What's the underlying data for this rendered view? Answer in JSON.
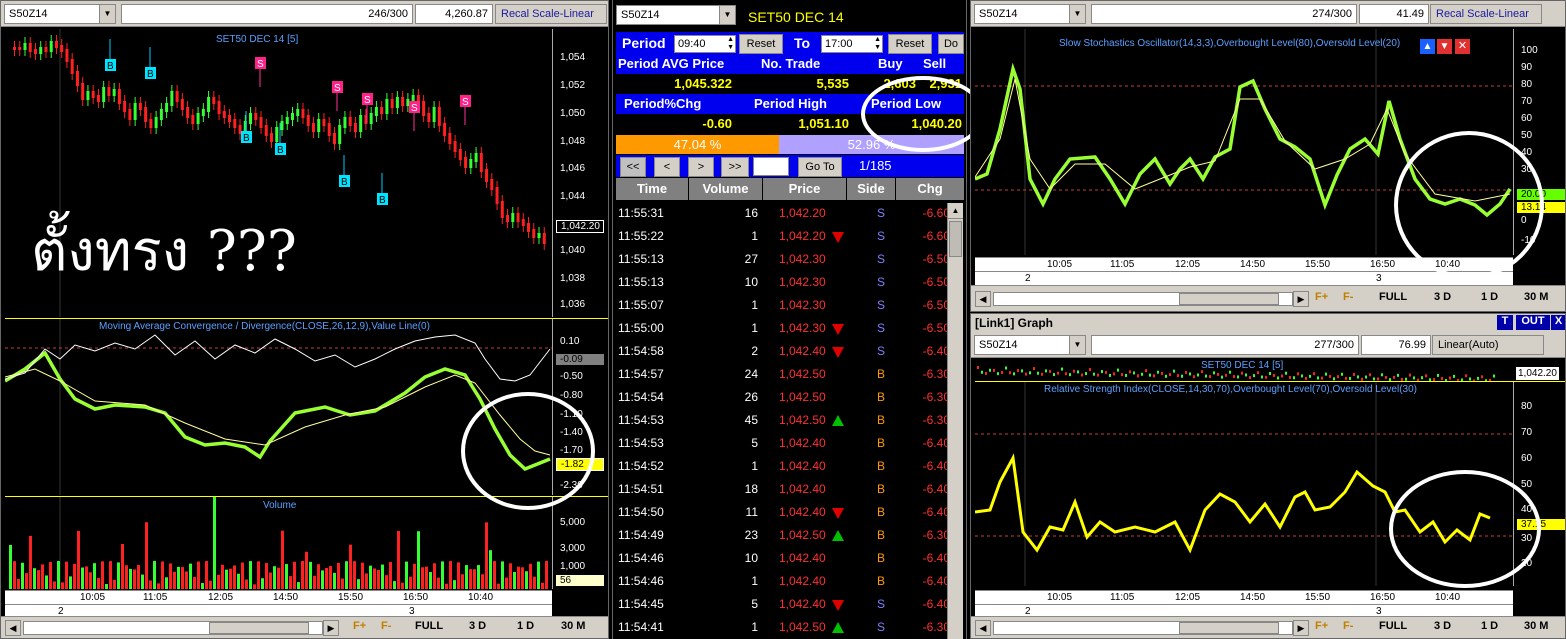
{
  "left_pane": {
    "symbol": "S50Z14",
    "counter": "246/300",
    "value": "4,260.87",
    "scale_button": "Recal Scale-Linear",
    "price_chart_label": "SET50 DEC 14   [5]",
    "price_ticks": [
      "1,054",
      "1,052",
      "1,050",
      "1,048",
      "1,046",
      "1,044",
      "1,042.20",
      "1,040",
      "1,038",
      "1,036"
    ],
    "macd_label": "Moving Average Convergence / Divergence(CLOSE,26,12,9),Value Line(0)",
    "macd_ticks": [
      "0.10",
      "-0.09",
      "-0.50",
      "-0.80",
      "-1.10",
      "-1.40",
      "-1.70",
      "-1.82",
      "-2.30"
    ],
    "volume_label": "Volume",
    "volume_ticks": [
      "5,000",
      "3,000",
      "1,000",
      "56"
    ],
    "x_ticks": [
      "10:05",
      "11:05",
      "12:05",
      "14:50",
      "15:50",
      "16:50",
      "10:40"
    ],
    "day_markers": [
      "2",
      "3"
    ],
    "bottom_buttons": [
      "F+",
      "F-",
      "FULL",
      "3 D",
      "1 D",
      "30 M"
    ],
    "thai_annotation": "ตั้งทรง ???",
    "signals_b": [
      "B",
      "B",
      "B",
      "B",
      "B",
      "B"
    ],
    "signals_s": [
      "S",
      "S",
      "S",
      "S",
      "S"
    ]
  },
  "middle_pane": {
    "symbol": "S50Z14",
    "title": "SET50 DEC 14",
    "period_label": "Period",
    "period_from": "09:40",
    "to_label": "To",
    "period_to": "17:00",
    "reset_label": "Reset",
    "do_label": "Do",
    "headers1": [
      "Period AVG Price",
      "No. Trade",
      "Buy",
      "Sell"
    ],
    "values1": [
      "1,045.322",
      "5,535",
      "2,603",
      "2,931"
    ],
    "headers2": [
      "Period%Chg",
      "Period High",
      "Period Low"
    ],
    "values2": [
      "-0.60",
      "1,051.10",
      "1,040.20"
    ],
    "buy_pct": "47.04 %",
    "sell_pct": "52.96 %",
    "nav_buttons": [
      "<<",
      "<",
      ">",
      ">>"
    ],
    "goto_label": "Go To",
    "page_info": "1/185",
    "table_headers": [
      "Time",
      "Volume",
      "Price",
      "Side",
      "Chg"
    ],
    "rows": [
      {
        "time": "11:55:31",
        "vol": "16",
        "price": "1,042.20",
        "arrow": "",
        "side": "S",
        "chg": "-6.60"
      },
      {
        "time": "11:55:22",
        "vol": "1",
        "price": "1,042.20",
        "arrow": "down",
        "side": "S",
        "chg": "-6.60"
      },
      {
        "time": "11:55:13",
        "vol": "27",
        "price": "1,042.30",
        "arrow": "",
        "side": "S",
        "chg": "-6.50"
      },
      {
        "time": "11:55:13",
        "vol": "10",
        "price": "1,042.30",
        "arrow": "",
        "side": "S",
        "chg": "-6.50"
      },
      {
        "time": "11:55:07",
        "vol": "1",
        "price": "1,042.30",
        "arrow": "",
        "side": "S",
        "chg": "-6.50"
      },
      {
        "time": "11:55:00",
        "vol": "1",
        "price": "1,042.30",
        "arrow": "down",
        "side": "S",
        "chg": "-6.50"
      },
      {
        "time": "11:54:58",
        "vol": "2",
        "price": "1,042.40",
        "arrow": "down",
        "side": "S",
        "chg": "-6.40"
      },
      {
        "time": "11:54:57",
        "vol": "24",
        "price": "1,042.50",
        "arrow": "",
        "side": "B",
        "chg": "-6.30"
      },
      {
        "time": "11:54:54",
        "vol": "26",
        "price": "1,042.50",
        "arrow": "",
        "side": "B",
        "chg": "-6.30"
      },
      {
        "time": "11:54:53",
        "vol": "45",
        "price": "1,042.50",
        "arrow": "up",
        "side": "B",
        "chg": "-6.30"
      },
      {
        "time": "11:54:53",
        "vol": "5",
        "price": "1,042.40",
        "arrow": "",
        "side": "B",
        "chg": "-6.40"
      },
      {
        "time": "11:54:52",
        "vol": "1",
        "price": "1,042.40",
        "arrow": "",
        "side": "B",
        "chg": "-6.40"
      },
      {
        "time": "11:54:51",
        "vol": "18",
        "price": "1,042.40",
        "arrow": "",
        "side": "B",
        "chg": "-6.40"
      },
      {
        "time": "11:54:50",
        "vol": "11",
        "price": "1,042.40",
        "arrow": "down",
        "side": "B",
        "chg": "-6.40"
      },
      {
        "time": "11:54:49",
        "vol": "23",
        "price": "1,042.50",
        "arrow": "up",
        "side": "B",
        "chg": "-6.30"
      },
      {
        "time": "11:54:46",
        "vol": "10",
        "price": "1,042.40",
        "arrow": "",
        "side": "B",
        "chg": "-6.40"
      },
      {
        "time": "11:54:46",
        "vol": "1",
        "price": "1,042.40",
        "arrow": "",
        "side": "B",
        "chg": "-6.40"
      },
      {
        "time": "11:54:45",
        "vol": "5",
        "price": "1,042.40",
        "arrow": "down",
        "side": "S",
        "chg": "-6.40"
      },
      {
        "time": "11:54:41",
        "vol": "1",
        "price": "1,042.50",
        "arrow": "up",
        "side": "S",
        "chg": "-6.30"
      }
    ]
  },
  "right_top": {
    "symbol": "S50Z14",
    "counter": "274/300",
    "value": "41.49",
    "scale_button": "Recal Scale-Linear",
    "label": "Slow Stochastics Oscillator(14,3,3),Overbought Level(80),Oversold Level(20)",
    "ticks": [
      "100",
      "90",
      "80",
      "70",
      "60",
      "50",
      "40",
      "30",
      "20.00",
      "13.14",
      "0",
      "-10"
    ],
    "x_ticks": [
      "10:05",
      "11:05",
      "12:05",
      "14:50",
      "15:50",
      "16:50",
      "10:40"
    ],
    "day_markers": [
      "2",
      "3"
    ],
    "bottom_buttons": [
      "F+",
      "F-",
      "FULL",
      "3 D",
      "1 D",
      "30 M"
    ]
  },
  "right_bottom": {
    "window_title": "[Link1] Graph",
    "t_label": "T",
    "out_label": "OUT",
    "x_label": "X",
    "symbol": "S50Z14",
    "counter": "277/300",
    "value": "76.99",
    "scale_button": "Linear(Auto)",
    "price_label": "SET50 DEC 14   [5]",
    "price_tag": "1,042.20",
    "label": "Relative Strength Index(CLOSE,14,30,70),Overbought Level(70),Oversold Level(30)",
    "ticks": [
      "80",
      "70",
      "60",
      "50",
      "40",
      "37.15",
      "30",
      "20"
    ],
    "x_ticks": [
      "10:05",
      "11:05",
      "12:05",
      "14:50",
      "15:50",
      "16:50",
      "10:40"
    ],
    "day_markers": [
      "2",
      "3"
    ],
    "bottom_buttons": [
      "F+",
      "F-",
      "FULL",
      "3 D",
      "1 D",
      "30 M"
    ]
  }
}
